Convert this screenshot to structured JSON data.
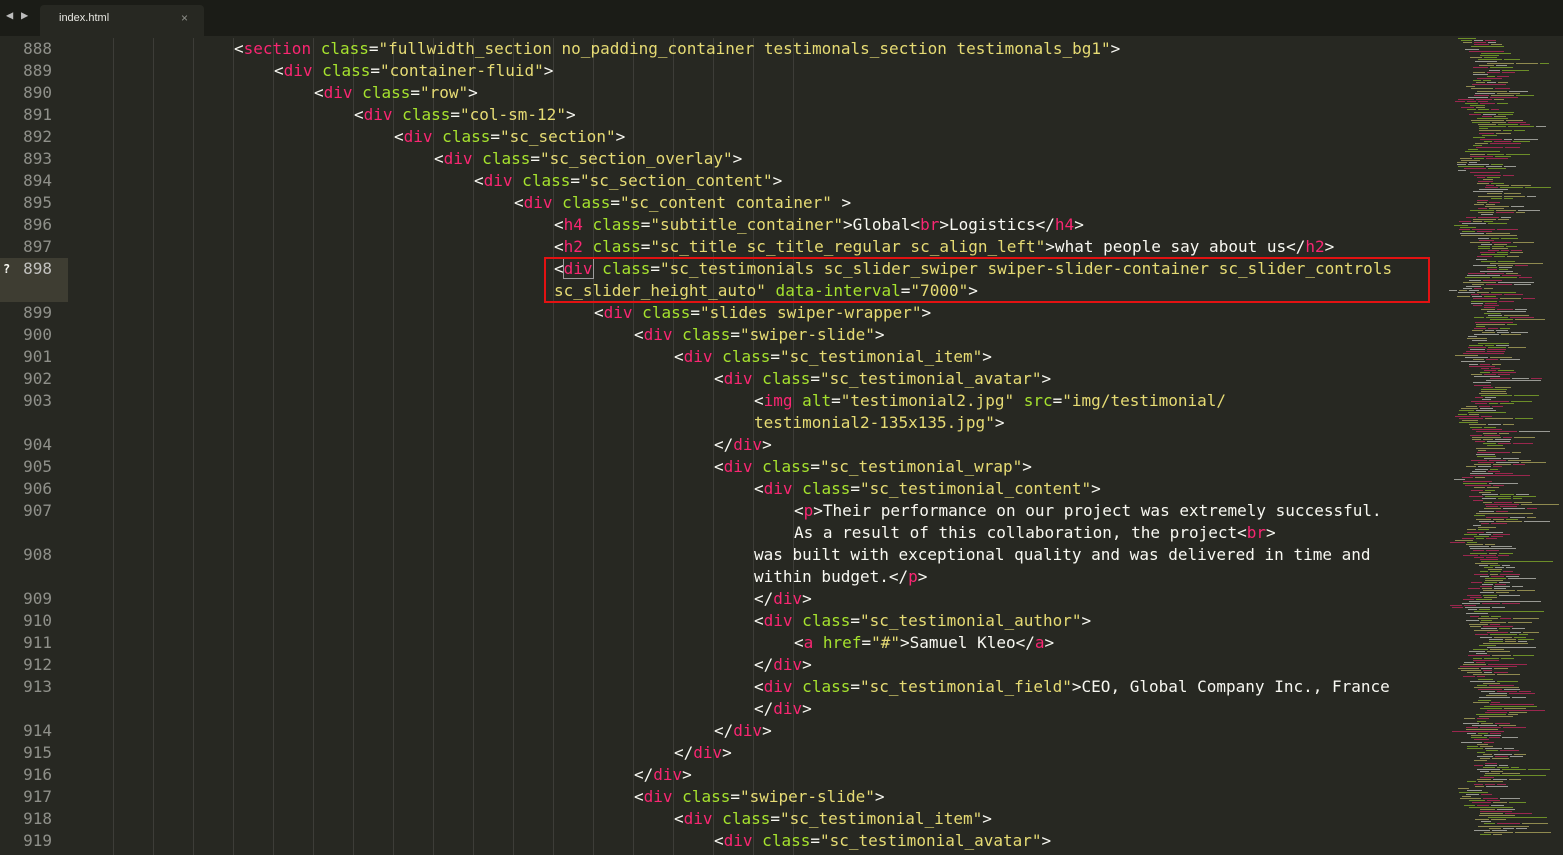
{
  "tabbar": {
    "back_icon": "◀",
    "forward_icon": "▶",
    "tab_label": "index.html",
    "close_icon": "×"
  },
  "editor": {
    "modified_marker": "?",
    "lines": [
      {
        "n": "888",
        "indent": 4,
        "tokens": [
          [
            "t",
            "<"
          ],
          [
            "g",
            "section"
          ],
          [
            "a",
            " class"
          ],
          [
            "t",
            "="
          ],
          [
            "s",
            "\"fullwidth_section no_padding_container testimonals_section testimonals_bg1\""
          ],
          [
            "t",
            ">"
          ]
        ]
      },
      {
        "n": "889",
        "indent": 5,
        "tokens": [
          [
            "t",
            "<"
          ],
          [
            "g",
            "div"
          ],
          [
            "a",
            " class"
          ],
          [
            "t",
            "="
          ],
          [
            "s",
            "\"container-fluid\""
          ],
          [
            "t",
            ">"
          ]
        ]
      },
      {
        "n": "890",
        "indent": 6,
        "tokens": [
          [
            "t",
            "<"
          ],
          [
            "g",
            "div"
          ],
          [
            "a",
            " class"
          ],
          [
            "t",
            "="
          ],
          [
            "s",
            "\"row\""
          ],
          [
            "t",
            ">"
          ]
        ]
      },
      {
        "n": "891",
        "indent": 7,
        "tokens": [
          [
            "t",
            "<"
          ],
          [
            "g",
            "div"
          ],
          [
            "a",
            " class"
          ],
          [
            "t",
            "="
          ],
          [
            "s",
            "\"col-sm-12\""
          ],
          [
            "t",
            ">"
          ]
        ]
      },
      {
        "n": "892",
        "indent": 8,
        "tokens": [
          [
            "t",
            "<"
          ],
          [
            "g",
            "div"
          ],
          [
            "a",
            " class"
          ],
          [
            "t",
            "="
          ],
          [
            "s",
            "\"sc_section\""
          ],
          [
            "t",
            ">"
          ]
        ]
      },
      {
        "n": "893",
        "indent": 9,
        "tokens": [
          [
            "t",
            "<"
          ],
          [
            "g",
            "div"
          ],
          [
            "a",
            " class"
          ],
          [
            "t",
            "="
          ],
          [
            "s",
            "\"sc_section_overlay\""
          ],
          [
            "t",
            ">"
          ]
        ]
      },
      {
        "n": "894",
        "indent": 10,
        "tokens": [
          [
            "t",
            "<"
          ],
          [
            "g",
            "div"
          ],
          [
            "a",
            " class"
          ],
          [
            "t",
            "="
          ],
          [
            "s",
            "\"sc_section_content\""
          ],
          [
            "t",
            ">"
          ]
        ]
      },
      {
        "n": "895",
        "indent": 11,
        "tokens": [
          [
            "t",
            "<"
          ],
          [
            "g",
            "div"
          ],
          [
            "a",
            " class"
          ],
          [
            "t",
            "="
          ],
          [
            "s",
            "\"sc_content container\""
          ],
          [
            "t",
            " >"
          ]
        ]
      },
      {
        "n": "896",
        "indent": 12,
        "tokens": [
          [
            "t",
            "<"
          ],
          [
            "g",
            "h4"
          ],
          [
            "a",
            " class"
          ],
          [
            "t",
            "="
          ],
          [
            "s",
            "\"subtitle_container\""
          ],
          [
            "t",
            ">Global<"
          ],
          [
            "g",
            "br"
          ],
          [
            "t",
            ">Logistics</"
          ],
          [
            "g",
            "h4"
          ],
          [
            "t",
            ">"
          ]
        ]
      },
      {
        "n": "897",
        "indent": 12,
        "tokens": [
          [
            "t",
            "<"
          ],
          [
            "g",
            "h2"
          ],
          [
            "a",
            " class"
          ],
          [
            "t",
            "="
          ],
          [
            "s",
            "\"sc_title sc_title_regular sc_align_left\""
          ],
          [
            "t",
            ">what people say about us</"
          ],
          [
            "g",
            "h2"
          ],
          [
            "t",
            ">"
          ]
        ]
      },
      {
        "n": "898",
        "indent": 12,
        "active": true,
        "tokens": [
          [
            "t",
            "<"
          ],
          [
            "gc",
            "div"
          ],
          [
            "a",
            " class"
          ],
          [
            "t",
            "="
          ],
          [
            "s",
            "\"sc_testimonials sc_slider_swiper swiper-slider-container sc_slider_controls"
          ]
        ]
      },
      {
        "n": "",
        "indent": 12,
        "tokens": [
          [
            "s",
            "sc_slider_height_auto\""
          ],
          [
            "a",
            " data-interval"
          ],
          [
            "t",
            "="
          ],
          [
            "s",
            "\"7000\""
          ],
          [
            "t",
            ">"
          ]
        ]
      },
      {
        "n": "899",
        "indent": 13,
        "tokens": [
          [
            "t",
            "<"
          ],
          [
            "g",
            "div"
          ],
          [
            "a",
            " class"
          ],
          [
            "t",
            "="
          ],
          [
            "s",
            "\"slides swiper-wrapper\""
          ],
          [
            "t",
            ">"
          ]
        ]
      },
      {
        "n": "900",
        "indent": 14,
        "tokens": [
          [
            "t",
            "<"
          ],
          [
            "g",
            "div"
          ],
          [
            "a",
            " class"
          ],
          [
            "t",
            "="
          ],
          [
            "s",
            "\"swiper-slide\""
          ],
          [
            "t",
            ">"
          ]
        ]
      },
      {
        "n": "901",
        "indent": 15,
        "tokens": [
          [
            "t",
            "<"
          ],
          [
            "g",
            "div"
          ],
          [
            "a",
            " class"
          ],
          [
            "t",
            "="
          ],
          [
            "s",
            "\"sc_testimonial_item\""
          ],
          [
            "t",
            ">"
          ]
        ]
      },
      {
        "n": "902",
        "indent": 16,
        "tokens": [
          [
            "t",
            "<"
          ],
          [
            "g",
            "div"
          ],
          [
            "a",
            " class"
          ],
          [
            "t",
            "="
          ],
          [
            "s",
            "\"sc_testimonial_avatar\""
          ],
          [
            "t",
            ">"
          ]
        ]
      },
      {
        "n": "903",
        "indent": 17,
        "tokens": [
          [
            "t",
            "<"
          ],
          [
            "g",
            "img"
          ],
          [
            "a",
            " alt"
          ],
          [
            "t",
            "="
          ],
          [
            "s",
            "\"testimonial2.jpg\""
          ],
          [
            "a",
            " src"
          ],
          [
            "t",
            "="
          ],
          [
            "s",
            "\"img/testimonial/"
          ]
        ]
      },
      {
        "n": "",
        "indent": 17,
        "tokens": [
          [
            "s",
            "testimonial2-135x135.jpg\""
          ],
          [
            "t",
            ">"
          ]
        ]
      },
      {
        "n": "904",
        "indent": 16,
        "tokens": [
          [
            "t",
            "</"
          ],
          [
            "g",
            "div"
          ],
          [
            "t",
            ">"
          ]
        ]
      },
      {
        "n": "905",
        "indent": 16,
        "tokens": [
          [
            "t",
            "<"
          ],
          [
            "g",
            "div"
          ],
          [
            "a",
            " class"
          ],
          [
            "t",
            "="
          ],
          [
            "s",
            "\"sc_testimonial_wrap\""
          ],
          [
            "t",
            ">"
          ]
        ]
      },
      {
        "n": "906",
        "indent": 17,
        "tokens": [
          [
            "t",
            "<"
          ],
          [
            "g",
            "div"
          ],
          [
            "a",
            " class"
          ],
          [
            "t",
            "="
          ],
          [
            "s",
            "\"sc_testimonial_content\""
          ],
          [
            "t",
            ">"
          ]
        ]
      },
      {
        "n": "907",
        "indent": 18,
        "tokens": [
          [
            "t",
            "<"
          ],
          [
            "g",
            "p"
          ],
          [
            "t",
            ">Their performance on our project was extremely successful."
          ]
        ]
      },
      {
        "n": "",
        "indent": 18,
        "tokens": [
          [
            "t",
            "As a result of this collaboration, the project<"
          ],
          [
            "g",
            "br"
          ],
          [
            "t",
            ">"
          ]
        ]
      },
      {
        "n": "908",
        "indent": 17,
        "tokens": [
          [
            "t",
            "was built with exceptional quality and was delivered in time and"
          ]
        ]
      },
      {
        "n": "",
        "indent": 17,
        "tokens": [
          [
            "t",
            "within budget.</"
          ],
          [
            "g",
            "p"
          ],
          [
            "t",
            ">"
          ]
        ]
      },
      {
        "n": "909",
        "indent": 17,
        "tokens": [
          [
            "t",
            "</"
          ],
          [
            "g",
            "div"
          ],
          [
            "t",
            ">"
          ]
        ]
      },
      {
        "n": "910",
        "indent": 17,
        "tokens": [
          [
            "t",
            "<"
          ],
          [
            "g",
            "div"
          ],
          [
            "a",
            " class"
          ],
          [
            "t",
            "="
          ],
          [
            "s",
            "\"sc_testimonial_author\""
          ],
          [
            "t",
            ">"
          ]
        ]
      },
      {
        "n": "911",
        "indent": 18,
        "tokens": [
          [
            "t",
            "<"
          ],
          [
            "g",
            "a"
          ],
          [
            "a",
            " href"
          ],
          [
            "t",
            "="
          ],
          [
            "s",
            "\"#\""
          ],
          [
            "t",
            ">Samuel Kleo</"
          ],
          [
            "g",
            "a"
          ],
          [
            "t",
            ">"
          ]
        ]
      },
      {
        "n": "912",
        "indent": 17,
        "tokens": [
          [
            "t",
            "</"
          ],
          [
            "g",
            "div"
          ],
          [
            "t",
            ">"
          ]
        ]
      },
      {
        "n": "913",
        "indent": 17,
        "tokens": [
          [
            "t",
            "<"
          ],
          [
            "g",
            "div"
          ],
          [
            "a",
            " class"
          ],
          [
            "t",
            "="
          ],
          [
            "s",
            "\"sc_testimonial_field\""
          ],
          [
            "t",
            ">CEO, Global Company Inc., France"
          ]
        ]
      },
      {
        "n": "",
        "indent": 17,
        "tokens": [
          [
            "t",
            "</"
          ],
          [
            "g",
            "div"
          ],
          [
            "t",
            ">"
          ]
        ]
      },
      {
        "n": "914",
        "indent": 16,
        "tokens": [
          [
            "t",
            "</"
          ],
          [
            "g",
            "div"
          ],
          [
            "t",
            ">"
          ]
        ]
      },
      {
        "n": "915",
        "indent": 15,
        "tokens": [
          [
            "t",
            "</"
          ],
          [
            "g",
            "div"
          ],
          [
            "t",
            ">"
          ]
        ]
      },
      {
        "n": "916",
        "indent": 14,
        "tokens": [
          [
            "t",
            "</"
          ],
          [
            "g",
            "div"
          ],
          [
            "t",
            ">"
          ]
        ]
      },
      {
        "n": "917",
        "indent": 14,
        "tokens": [
          [
            "t",
            "<"
          ],
          [
            "g",
            "div"
          ],
          [
            "a",
            " class"
          ],
          [
            "t",
            "="
          ],
          [
            "s",
            "\"swiper-slide\""
          ],
          [
            "t",
            ">"
          ]
        ]
      },
      {
        "n": "918",
        "indent": 15,
        "tokens": [
          [
            "t",
            "<"
          ],
          [
            "g",
            "div"
          ],
          [
            "a",
            " class"
          ],
          [
            "t",
            "="
          ],
          [
            "s",
            "\"sc_testimonial_item\""
          ],
          [
            "t",
            ">"
          ]
        ]
      },
      {
        "n": "919",
        "indent": 16,
        "tokens": [
          [
            "t",
            "<"
          ],
          [
            "g",
            "div"
          ],
          [
            "a",
            " class"
          ],
          [
            "t",
            "="
          ],
          [
            "s",
            "\"sc_testimonial_avatar\""
          ],
          [
            "t",
            ">"
          ]
        ]
      }
    ]
  },
  "colors": {
    "background": "#272822",
    "tag": "#f92672",
    "attribute": "#a6e22e",
    "string": "#e6db74",
    "text": "#f8f8f2",
    "line_number": "#8f908a",
    "highlight_box": "#e31212"
  }
}
